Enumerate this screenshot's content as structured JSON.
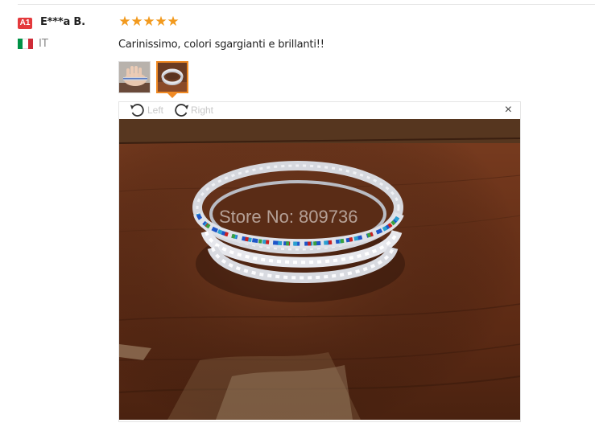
{
  "reviewer": {
    "level_badge": "A1",
    "name": "E***a B.",
    "country": "IT",
    "flag_colors": [
      "#009246",
      "#ffffff",
      "#ce2b37"
    ]
  },
  "rating": {
    "stars": 5,
    "star_glyph": "★",
    "color": "#f29a1e"
  },
  "review": {
    "text": "Carinissimo, colori sgargianti e brillanti!!"
  },
  "thumbnails": [
    {
      "icon": "hand-bracelet-thumbnail"
    },
    {
      "icon": "bracelet-thumbnail",
      "selected": true
    }
  ],
  "viewer": {
    "rotate_left_label": "Left",
    "rotate_right_label": "Right",
    "close_glyph": "×",
    "watermark": "Store No: 809736"
  },
  "colors": {
    "accent": "#f08a24",
    "badge": "#e4393c"
  }
}
